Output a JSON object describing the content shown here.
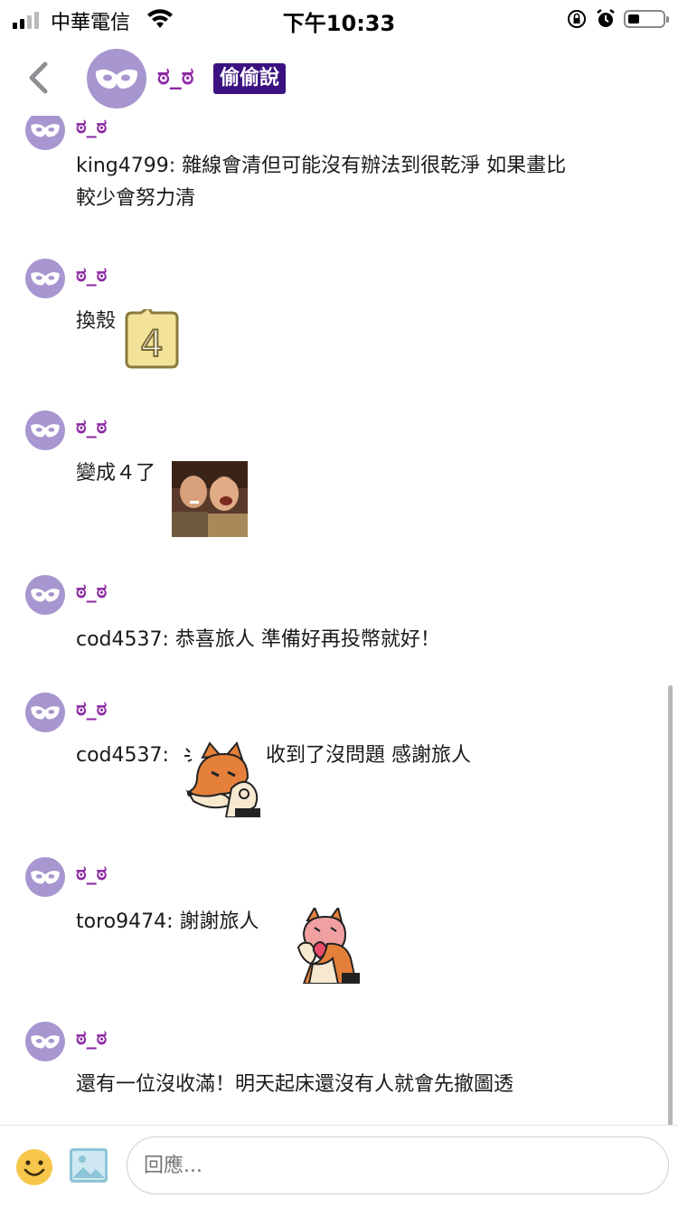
{
  "status_bar": {
    "carrier": "中華電信",
    "time": "下午10:33"
  },
  "header": {
    "name": "ಠ_ಠ",
    "badge": "偷偷說"
  },
  "messages": [
    {
      "name": "ಠ_ಠ",
      "text": "king4799: 雜線會清但可能沒有辦法到很乾淨 如果畫比",
      "text2": "較少會努力清"
    },
    {
      "name": "ಠ_ಠ",
      "text": "換殼",
      "sticker": "number-4-sticker",
      "sticker_label": "4"
    },
    {
      "name": "ಠ_ಠ",
      "text": "變成４了",
      "sticker": "laughing-men-photo"
    },
    {
      "name": "ಠ_ಠ",
      "text": "cod4537: 恭喜旅人 準備好再投幣就好！"
    },
    {
      "name": "ಠ_ಠ",
      "text": "cod4537:",
      "text_after": "收到了沒問題 感謝旅人",
      "sticker": "fox-ok-sticker"
    },
    {
      "name": "ಠ_ಠ",
      "text": "toro9474: 謝謝旅人",
      "sticker": "fox-heart-sticker"
    },
    {
      "name": "ಠ_ಠ",
      "text": "還有一位沒收滿！明天起床還沒有人就會先撤圖透"
    }
  ],
  "composer": {
    "placeholder": "回應..."
  },
  "colors": {
    "name": "#8c2ba4",
    "badge_bg": "#3b1280",
    "avatar_bg": "#a796cf"
  }
}
